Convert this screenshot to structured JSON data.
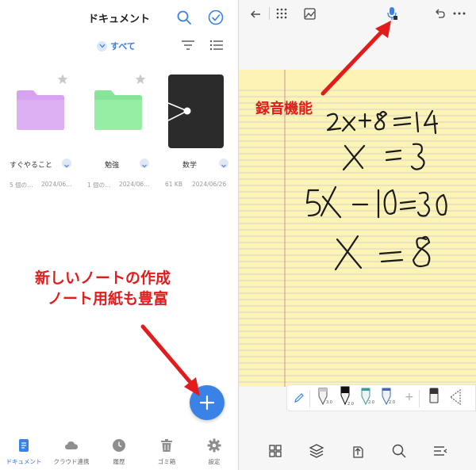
{
  "left_panel": {
    "title": "ドキュメント",
    "filter_label": "すべて",
    "items": [
      {
        "name": "すぐやること",
        "meta_left": "5 個の…",
        "meta_right": "2024/06…",
        "color": "#d7a2ef"
      },
      {
        "name": "勉強",
        "meta_left": "1 個の…",
        "meta_right": "2024/06…",
        "color": "#96eda4"
      },
      {
        "name": "数学",
        "meta_left": "61 KB",
        "meta_right": "2024/06/26",
        "color": "#2b2b2b"
      }
    ],
    "nav": [
      {
        "label": "ドキュメント",
        "icon": "document-icon",
        "active": true
      },
      {
        "label": "クラウド連携",
        "icon": "cloud-icon",
        "active": false
      },
      {
        "label": "履歴",
        "icon": "clock-icon",
        "active": false
      },
      {
        "label": "ゴミ箱",
        "icon": "trash-icon",
        "active": false
      },
      {
        "label": "設定",
        "icon": "gear-icon",
        "active": false
      }
    ]
  },
  "annotations": {
    "left_line1": "新しいノートの作成",
    "left_line2": "ノート用紙も豊富",
    "right": "録音機能"
  },
  "handwriting": {
    "line1": "2x+8=14",
    "line2": "x=3",
    "line3": "5x-10=30",
    "line4": "x=8"
  },
  "toolbar": {
    "pen1_size": "3.0",
    "pen2_size": "2.0",
    "pen3_size": "2.0",
    "pen4_size": "2.0",
    "plus": "+"
  },
  "colors": {
    "accent": "#3b82e6",
    "annotation": "#e21c1c",
    "paper": "#fdf3b5",
    "paper_line": "#a9b8de",
    "margin_line": "#c98a8a"
  }
}
